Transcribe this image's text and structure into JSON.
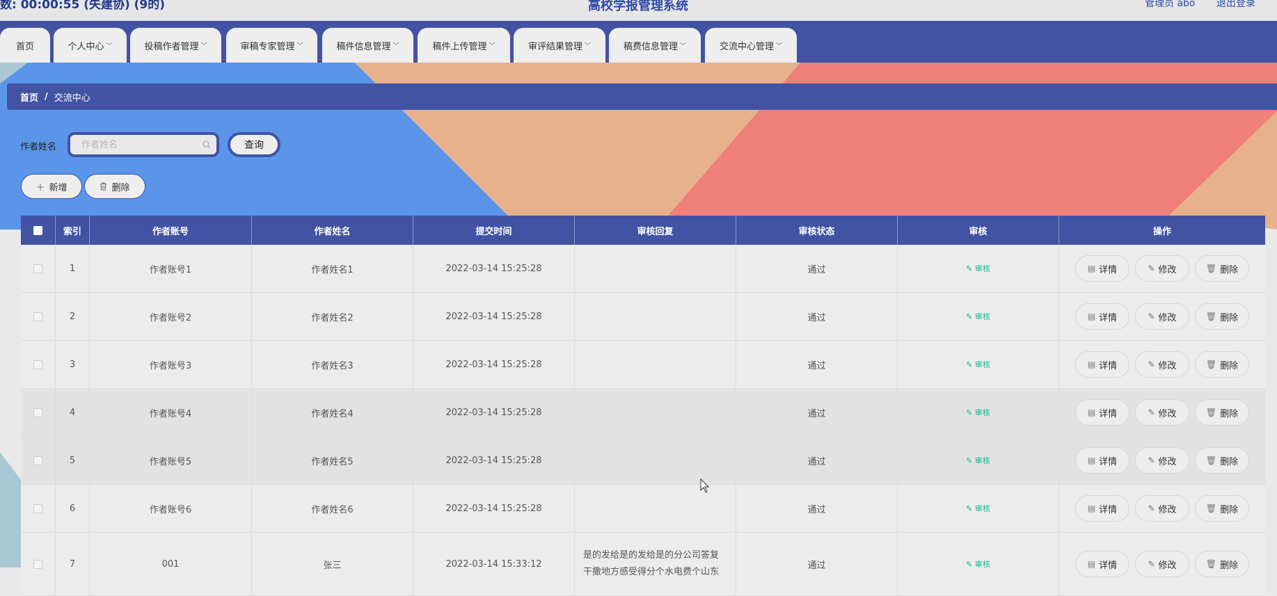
{
  "topbar": {
    "left_text": "数: 00:00:55 (失建协) (9的)",
    "title": "高校学报管理系统",
    "user": "管理员 abo",
    "logout": "退出登录"
  },
  "nav": {
    "items": [
      {
        "label": "首页"
      },
      {
        "label": "个人中心"
      },
      {
        "label": "投稿作者管理"
      },
      {
        "label": "审稿专家管理"
      },
      {
        "label": "稿件信息管理"
      },
      {
        "label": "稿件上传管理"
      },
      {
        "label": "审评结果管理"
      },
      {
        "label": "稿费信息管理"
      },
      {
        "label": "交流中心管理"
      }
    ],
    "chevron": "﹀"
  },
  "breadcrumb": {
    "home": "首页",
    "separator": "/",
    "current": "交流中心"
  },
  "search": {
    "label": "作者姓名",
    "placeholder": "作者姓名",
    "value": "",
    "button": "查询"
  },
  "actions": {
    "add": "新增",
    "add_icon": "＋",
    "delete": "删除"
  },
  "table": {
    "headers": [
      "索引",
      "作者账号",
      "作者姓名",
      "提交时间",
      "审核回复",
      "审核状态",
      "审核",
      "操作"
    ],
    "audit_label": "审核",
    "ops": {
      "detail": "详情",
      "edit": "修改",
      "delete": "删除"
    },
    "rows": [
      {
        "index": "1",
        "account": "作者账号1",
        "name": "作者姓名1",
        "time": "2022-03-14 15:25:28",
        "reply": "",
        "status": "通过"
      },
      {
        "index": "2",
        "account": "作者账号2",
        "name": "作者姓名2",
        "time": "2022-03-14 15:25:28",
        "reply": "",
        "status": "通过"
      },
      {
        "index": "3",
        "account": "作者账号3",
        "name": "作者姓名3",
        "time": "2022-03-14 15:25:28",
        "reply": "",
        "status": "通过"
      },
      {
        "index": "4",
        "account": "作者账号4",
        "name": "作者姓名4",
        "time": "2022-03-14 15:25:28",
        "reply": "",
        "status": "通过"
      },
      {
        "index": "5",
        "account": "作者账号5",
        "name": "作者姓名5",
        "time": "2022-03-14 15:25:28",
        "reply": "",
        "status": "通过"
      },
      {
        "index": "6",
        "account": "作者账号6",
        "name": "作者姓名6",
        "time": "2022-03-14 15:25:28",
        "reply": "",
        "status": "通过"
      },
      {
        "index": "7",
        "account": "001",
        "name": "张三",
        "time": "2022-03-14 15:33:12",
        "reply": "是的发给是的发给是的分公司答复干撒地方感受得分个水电费个山东",
        "status": "通过"
      }
    ]
  },
  "colors": {
    "primary": "#4253a3",
    "audit": "#1ab394",
    "bg_blue": "#5b95ea",
    "bg_orange": "#e6b18b",
    "bg_red": "#ef8079"
  }
}
